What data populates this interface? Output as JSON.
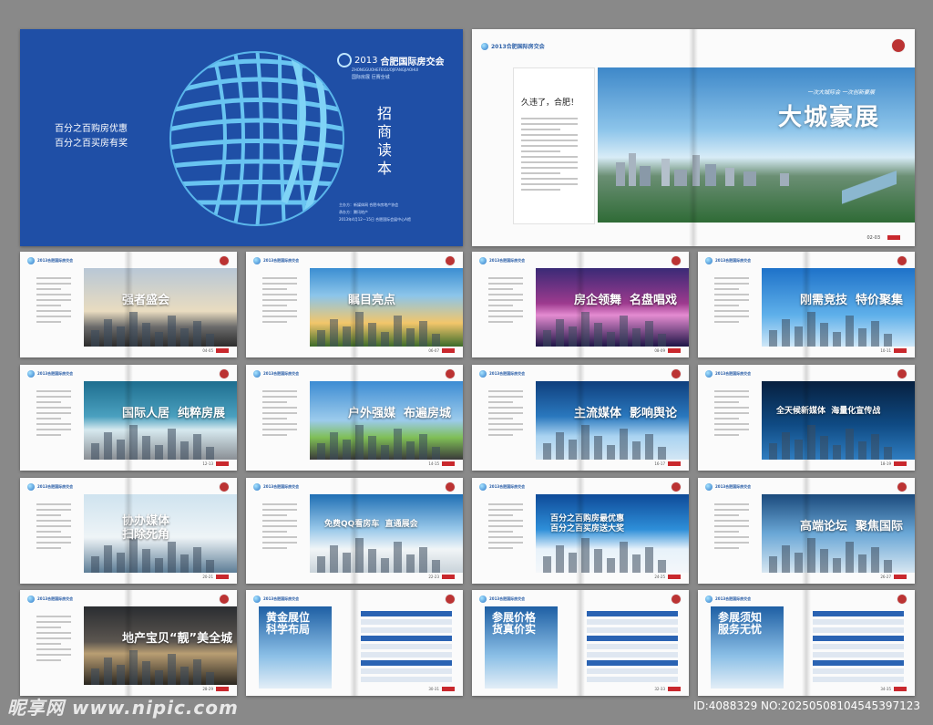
{
  "cover": {
    "logo_year": "2013",
    "logo_title": "合肥国际房交会",
    "logo_pinyin": "ZHONGGUOHEFEIGUOJIFANGJIAOHUI",
    "logo_tagline": "国际房展 巨赛全城",
    "slogan_1": "百分之百购房优惠",
    "slogan_2": "百分之百买房有奖",
    "vertical_title": "招商读本",
    "organizer_line1": "主办方：新媒体网  合肥市房地产协会",
    "organizer_line2": "承办方：腾讯地产",
    "date_line": "2013年4月12—15日  合肥国际会展中心A馆"
  },
  "intro": {
    "logo_text": "2013合肥国际房交会",
    "heading": "久违了，合肥！",
    "body_lines": [
      "",
      "",
      "",
      "",
      "",
      "",
      "",
      "",
      "",
      "",
      "",
      "",
      "",
      "",
      "",
      "",
      ""
    ],
    "slogan": "一次大城际会  一次创新豪展",
    "big_title": "大城豪展",
    "page_no": "02-03"
  },
  "spreads": [
    {
      "title": "强者盛会",
      "sub": "",
      "num": "04-05",
      "theme": "dusk"
    },
    {
      "title": "瞩目亮点",
      "sub": "",
      "num": "06-07",
      "theme": "gold"
    },
    {
      "title": "房企领舞  名盘唱戏",
      "sub": "",
      "num": "08-09",
      "theme": "night"
    },
    {
      "title": "刚需竞技  特价聚集",
      "sub": "",
      "num": "10-11",
      "theme": "sky"
    },
    {
      "title": "国际人居  纯粹房展",
      "sub": "",
      "num": "12-13",
      "theme": "city"
    },
    {
      "title": "户外强媒  布遍房城",
      "sub": "",
      "num": "14-15",
      "theme": "road"
    },
    {
      "title": "主流媒体  影响舆论",
      "sub": "",
      "num": "16-17",
      "theme": "tech"
    },
    {
      "title": "全天候新媒体  海量化宣传战",
      "sub": "",
      "num": "18-19",
      "theme": "deep"
    },
    {
      "title": "协办媒体\n扫除死角",
      "sub": "",
      "num": "20-21",
      "theme": "lens"
    },
    {
      "title": "免费QQ看房车  直通展会",
      "sub": "",
      "num": "22-23",
      "theme": "bus"
    },
    {
      "title": "百分之百购房最优惠\n百分之百买房送大奖",
      "sub": "",
      "num": "24-25",
      "theme": "gift"
    },
    {
      "title": "高端论坛  聚焦国际",
      "sub": "",
      "num": "26-27",
      "theme": "suit"
    },
    {
      "title": "地产宝贝“靓”美全城",
      "sub": "",
      "num": "28-29",
      "theme": "model"
    },
    {
      "title": "黄金展位\n科学布局",
      "sub": "",
      "num": "30-31",
      "theme": "plan"
    },
    {
      "title": "参展价格\n货真价实",
      "sub": "",
      "num": "32-33",
      "theme": "price"
    },
    {
      "title": "参展须知\n服务无忧",
      "sub": "",
      "num": "34-35",
      "theme": "notice"
    }
  ],
  "watermark": {
    "brand": "昵享网 www.nipic.com",
    "id_text": "ID:4088329 NO:20250508104545397123"
  },
  "colors": {
    "cover_blue": "#1f4fa6",
    "accent_red": "#c9282d",
    "bg_gray": "#898989"
  }
}
